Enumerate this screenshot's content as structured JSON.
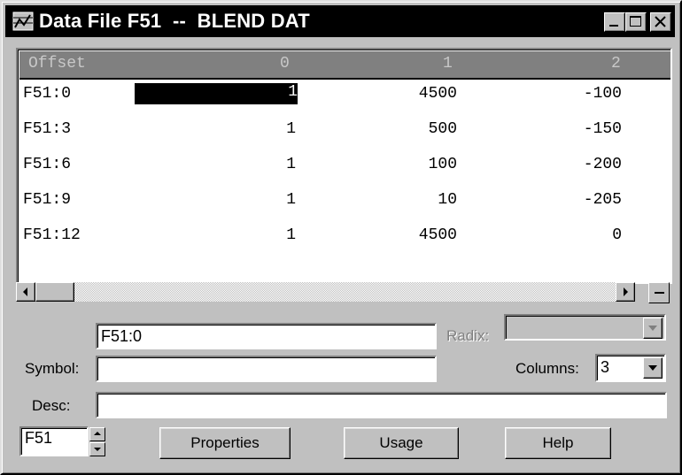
{
  "window": {
    "title": "Data File F51  --  BLEND DAT",
    "icon": "data-table-icon"
  },
  "grid": {
    "headers": [
      "Offset",
      "0",
      "1",
      "2"
    ],
    "rows": [
      {
        "offset": "F51:0",
        "c0": "1",
        "c1": "4500",
        "c2": "-100"
      },
      {
        "offset": "F51:3",
        "c0": "1",
        "c1": "500",
        "c2": "-150"
      },
      {
        "offset": "F51:6",
        "c0": "1",
        "c1": "100",
        "c2": "-200"
      },
      {
        "offset": "F51:9",
        "c0": "1",
        "c1": "10",
        "c2": "-205"
      },
      {
        "offset": "F51:12",
        "c0": "1",
        "c1": "4500",
        "c2": "0"
      }
    ],
    "selected_cell": "F51:0 / 0"
  },
  "form": {
    "address_value": "F51:0",
    "radix_label": "Radix:",
    "radix_value": "",
    "symbol_label": "Symbol:",
    "symbol_value": "",
    "columns_label": "Columns:",
    "columns_value": "3",
    "desc_label": "Desc:",
    "desc_value": "",
    "file_value": "F51"
  },
  "buttons": {
    "properties": "Properties",
    "usage": "Usage",
    "help": "Help"
  }
}
